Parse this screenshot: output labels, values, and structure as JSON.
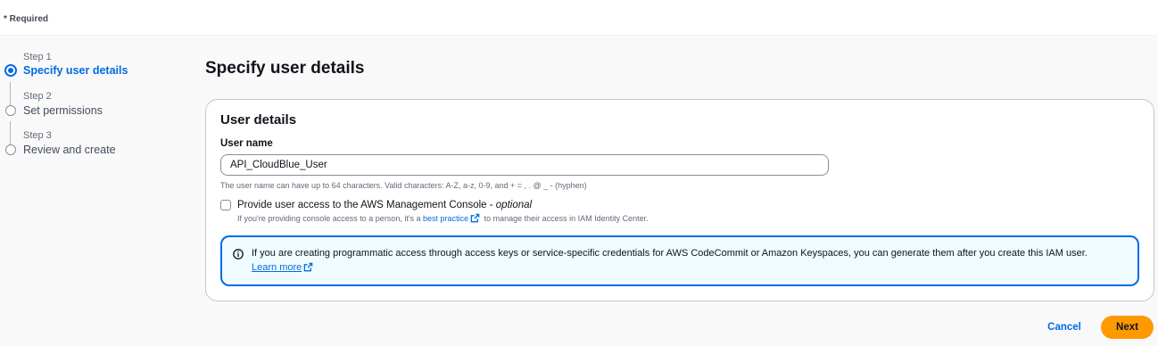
{
  "required_text": "* Required",
  "steps": [
    {
      "step_label": "Step 1",
      "title": "Specify user details",
      "active": true
    },
    {
      "step_label": "Step 2",
      "title": "Set permissions",
      "active": false
    },
    {
      "step_label": "Step 3",
      "title": "Review and create",
      "active": false
    }
  ],
  "page_title": "Specify user details",
  "panel": {
    "title": "User details",
    "username_label": "User name",
    "username_value": "API_CloudBlue_User",
    "username_hint": "The user name can have up to 64 characters. Valid characters: A-Z, a-z, 0-9, and + = , . @ _ - (hyphen)",
    "console_access": {
      "label": "Provide user access to the AWS Management Console - ",
      "label_optional": "optional",
      "checked": false,
      "desc_before": "If you're providing console access to a person, it's a ",
      "desc_link": "best practice",
      "desc_after": " to manage their access in IAM Identity Center."
    },
    "info": {
      "text": "If you are creating programmatic access through access keys or service-specific credentials for AWS CodeCommit or Amazon Keyspaces, you can generate them after you create this IAM user.",
      "link": "Learn more"
    }
  },
  "actions": {
    "cancel": "Cancel",
    "next": "Next"
  },
  "colors": {
    "accent": "#006ce0",
    "primary_button": "#ff9900",
    "info_background": "#f0fbff"
  }
}
